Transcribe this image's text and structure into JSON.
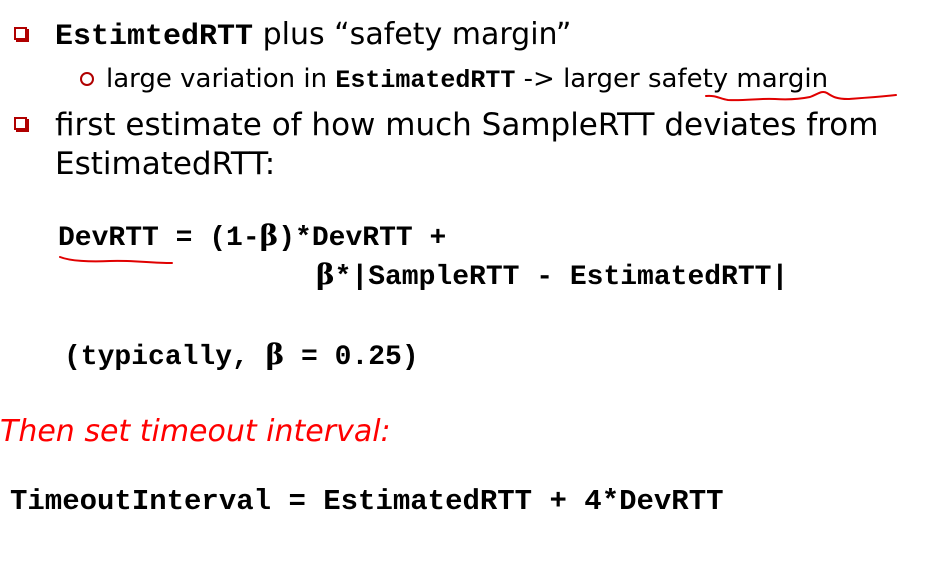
{
  "bullet1": {
    "code": "EstimtedRTT",
    "text": " plus “safety margin”"
  },
  "bullet1_sub": {
    "text_before": "large variation in ",
    "code": "EstimatedRTT",
    "text_after": " -> larger ",
    "underlined": "safety margin"
  },
  "bullet2": {
    "line1": "first estimate of how much SampleRTT deviates from",
    "line2": "EstimatedRTT:"
  },
  "formula": {
    "lhs": "DevRTT",
    "op1": " = (1-",
    "beta": "β",
    "rest1": ")*DevRTT +",
    "beta2": "β",
    "rest2": "*|SampleRTT - EstimatedRTT|"
  },
  "typical": {
    "prefix": "(typically, ",
    "beta": "β",
    "suffix": " = 0.25)"
  },
  "then_text": "Then set timeout interval:",
  "timeout_formula": "TimeoutInterval = EstimatedRTT + 4*DevRTT",
  "colors": {
    "bullet": "#b00000",
    "highlight_text": "#ff0000",
    "annotation_ink": "#e00000"
  }
}
